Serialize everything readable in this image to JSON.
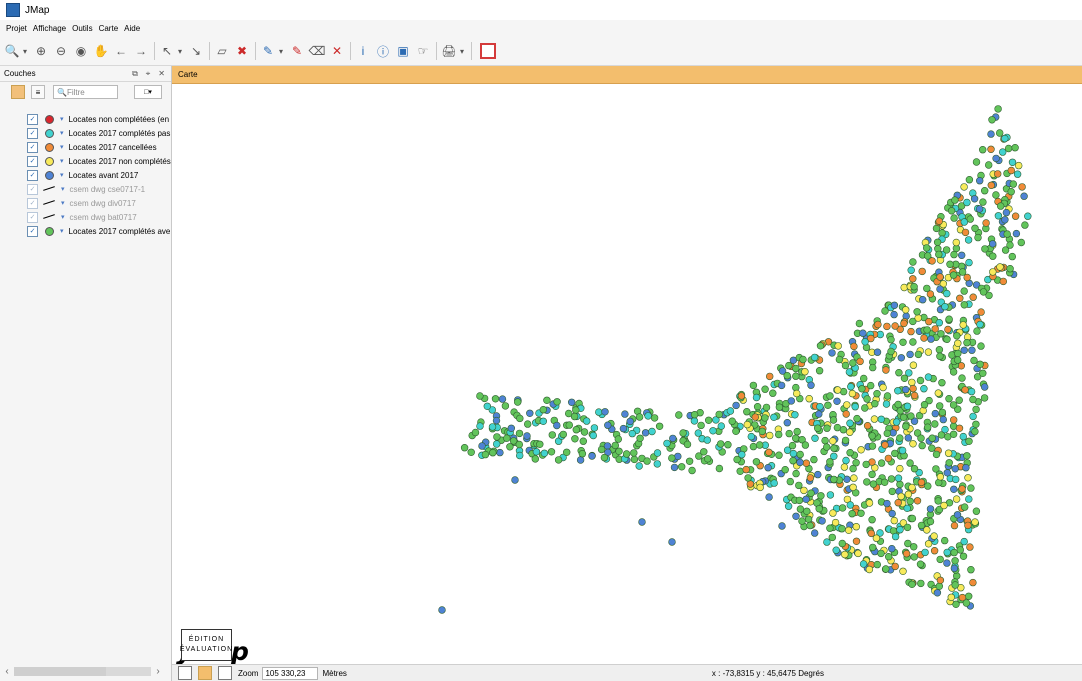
{
  "window": {
    "title": "JMap"
  },
  "menu": [
    "Projet",
    "Affichage",
    "Outils",
    "Carte",
    "Aide"
  ],
  "panel": {
    "title": "Couches",
    "filter_placeholder": "Filtre",
    "layers": [
      {
        "label": "Locates non complétées (en",
        "color": "#d9262d",
        "kind": "dot",
        "enabled": true
      },
      {
        "label": "Locates 2017 complétés pas",
        "color": "#41d2cf",
        "kind": "dot",
        "enabled": true
      },
      {
        "label": "Locates 2017 cancellées",
        "color": "#f08b38",
        "kind": "dot",
        "enabled": true
      },
      {
        "label": "Locates 2017 non complétés",
        "color": "#f8ea5b",
        "kind": "dot",
        "enabled": true
      },
      {
        "label": "Locates avant 2017",
        "color": "#4f83d4",
        "kind": "dot",
        "enabled": true
      },
      {
        "label": "csem dwg cse0717-1",
        "color": "#000000",
        "kind": "line",
        "enabled": false
      },
      {
        "label": "csem dwg div0717",
        "color": "#000000",
        "kind": "line",
        "enabled": false
      },
      {
        "label": "csem dwg bat0717",
        "color": "#000000",
        "kind": "line",
        "enabled": false
      },
      {
        "label": "Locates 2017 complétés ave",
        "color": "#62c45b",
        "kind": "dot",
        "enabled": true
      }
    ]
  },
  "map": {
    "tab": "Carte",
    "logo_text": "JMap",
    "edition_line1": "ÉDITION",
    "edition_line2": "ÉVALUATION"
  },
  "status": {
    "zoom_label": "Zoom",
    "zoom_value": "105 330,23",
    "unit": "Mètres",
    "coords": "x : -73,8315  y : 45,6475 Degrés"
  },
  "toolbar_icons": [
    "search-icon",
    "zoom-in-icon",
    "zoom-out-icon",
    "zoom-region-icon",
    "pan-icon",
    "back-icon",
    "forward-icon",
    "select-icon",
    "deselect-icon",
    "polygon-icon",
    "polygon-remove-icon",
    "measure-icon",
    "measure-remove-icon",
    "clear-icon",
    "info-icon",
    "circle-info-icon",
    "info-box-icon",
    "hand-icon",
    "print-icon",
    "color-box-icon"
  ]
}
